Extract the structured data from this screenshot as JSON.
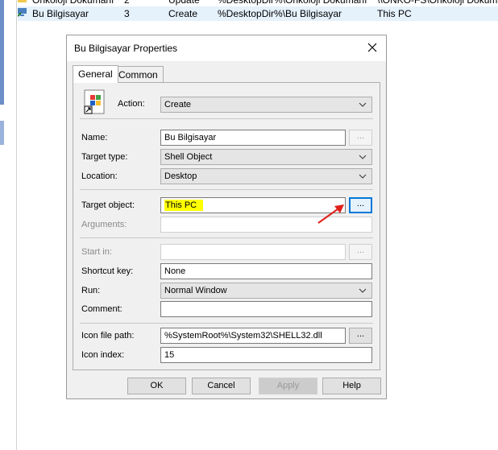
{
  "background": {
    "rows": [
      {
        "name": "Onkoloji Dokumanı",
        "order": "2",
        "action": "Update",
        "target": "%DesktopDir%\\Onkoloji Dokumanı",
        "path": "\\\\ONKO-FS\\Onkoloji Dokumanı"
      },
      {
        "name": "Bu Bilgisayar",
        "order": "3",
        "action": "Create",
        "target": "%DesktopDir%\\Bu Bilgisayar",
        "path": "This PC"
      }
    ]
  },
  "dialog": {
    "title": "Bu Bilgisayar Properties",
    "tabs": [
      "General",
      "Common"
    ],
    "action": {
      "label": "Action:",
      "value": "Create"
    },
    "name": {
      "label": "Name:",
      "value": "Bu Bilgisayar"
    },
    "target_type": {
      "label": "Target type:",
      "value": "Shell Object"
    },
    "location": {
      "label": "Location:",
      "value": "Desktop"
    },
    "target_object": {
      "label": "Target object:",
      "value": "This PC"
    },
    "arguments": {
      "label": "Arguments:",
      "value": ""
    },
    "start_in": {
      "label": "Start in:",
      "value": ""
    },
    "shortcut_key": {
      "label": "Shortcut key:",
      "value": "None"
    },
    "run": {
      "label": "Run:",
      "value": "Normal Window"
    },
    "comment": {
      "label": "Comment:",
      "value": ""
    },
    "icon_file_path": {
      "label": "Icon file path:",
      "value": "%SystemRoot%\\System32\\SHELL32.dll"
    },
    "icon_index": {
      "label": "Icon index:",
      "value": "15"
    },
    "browse_label": "...",
    "buttons": {
      "ok": "OK",
      "cancel": "Cancel",
      "apply": "Apply",
      "help": "Help"
    }
  },
  "colors": {
    "highlight": "#ffff00",
    "focus": "#0078d7",
    "arrow": "#e0201a"
  }
}
